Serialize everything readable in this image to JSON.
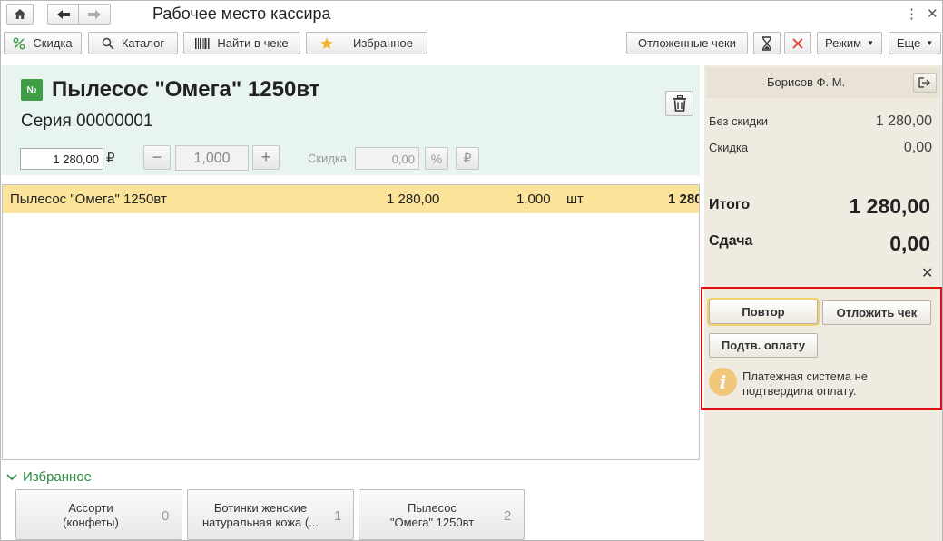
{
  "window": {
    "title": "Рабочее место кассира"
  },
  "toolbar": {
    "discount": "Скидка",
    "catalog": "Каталог",
    "find_in_check": "Найти в чеке",
    "favorites": "Избранное",
    "deferred_checks": "Отложенные чеки",
    "mode": "Режим",
    "more": "Еще"
  },
  "item": {
    "badge": "№",
    "name": "Пылесос \"Омега\" 1250вт",
    "series": "Серия 00000001",
    "price": "1 280,00",
    "currency": "₽",
    "quantity": "1,000",
    "discount_label": "Скидка",
    "discount_value": "0,00",
    "percent_sign": "%",
    "ruble_sign": "₽"
  },
  "table": {
    "rows": [
      {
        "name": "Пылесос \"Омега\" 1250вт",
        "price": "1 280,00",
        "qty": "1,000",
        "unit": "шт",
        "sum": "1 280"
      }
    ]
  },
  "favorites": {
    "header": "Избранное",
    "items": [
      {
        "line1": "Ассорти",
        "line2": "(конфеты)",
        "num": "0"
      },
      {
        "line1": "Ботинки женские",
        "line2": "натуральная кожа (...",
        "num": "1"
      },
      {
        "line1": "Пылесос",
        "line2": "\"Омега\" 1250вт",
        "num": "2"
      }
    ]
  },
  "summary": {
    "cashier": "Борисов Ф. М.",
    "no_discount_label": "Без скидки",
    "no_discount_value": "1 280,00",
    "discount_label": "Скидка",
    "discount_value": "0,00",
    "total_label": "Итого",
    "total_value": "1 280,00",
    "change_label": "Сдача",
    "change_value": "0,00"
  },
  "payment": {
    "repeat": "Повтор",
    "defer_check": "Отложить чек",
    "confirm_payment": "Подтв. оплату",
    "info_line1": "Платежная система не",
    "info_line2": "подтвердила оплату."
  },
  "colors": {
    "accent_green": "#3f9d46",
    "row_highlight": "#fbe49a",
    "panel_bg": "#f0ebe0",
    "frame_red": "#e01010"
  }
}
